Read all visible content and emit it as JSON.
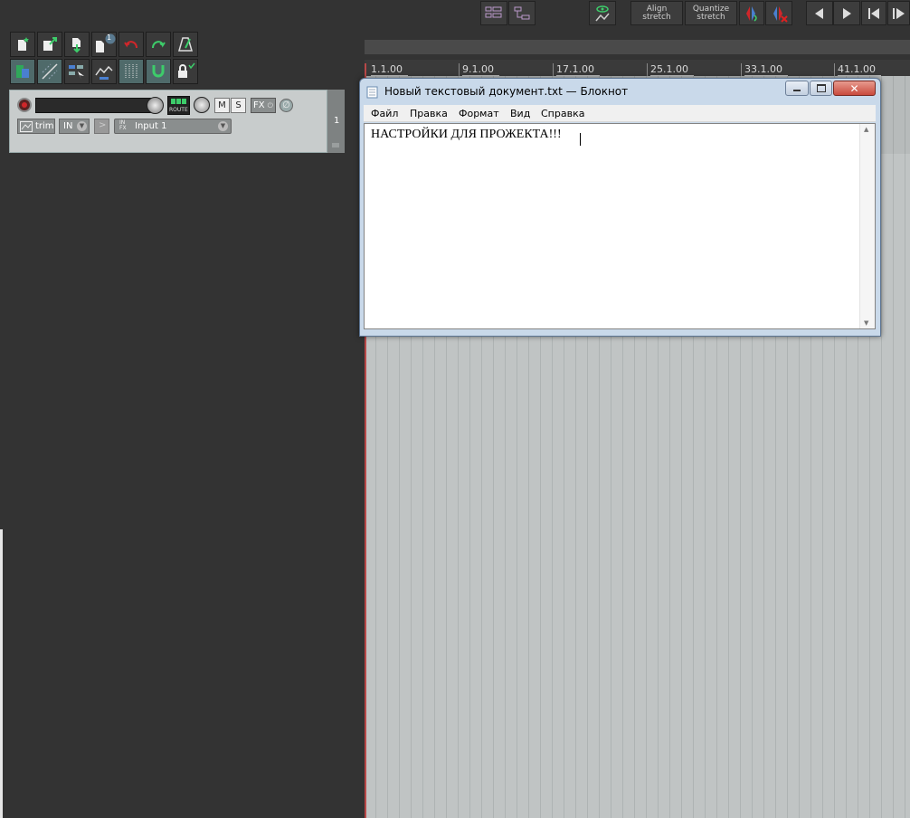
{
  "toolbar": {
    "align_stretch": "Align\nstretch",
    "quantize_stretch": "Quantize\nstretch"
  },
  "track_tools": {
    "new_project_badge": "1"
  },
  "track": {
    "route_label": "ROUTE",
    "mute_label": "M",
    "solo_label": "S",
    "fx_label": "FX",
    "trim_label": "trim",
    "in_label": "IN",
    "input_name": "Input 1",
    "track_number": "1"
  },
  "ruler": {
    "markers": [
      "1.1.00",
      "9.1.00",
      "17.1.00",
      "25.1.00",
      "33.1.00",
      "41.1.00"
    ]
  },
  "notepad": {
    "title": "Новый текстовый документ.txt — Блокнот",
    "menu": [
      "Файл",
      "Правка",
      "Формат",
      "Вид",
      "Справка"
    ],
    "content": "НАСТРОЙКИ ДЛЯ ПРОЖЕКТА!!!"
  },
  "colors": {
    "background": "#333333",
    "arrange": "#c0c4c4",
    "accent_green": "#3dcc6a",
    "accent_red": "#d0262a",
    "close_button": "#c94a3d"
  }
}
